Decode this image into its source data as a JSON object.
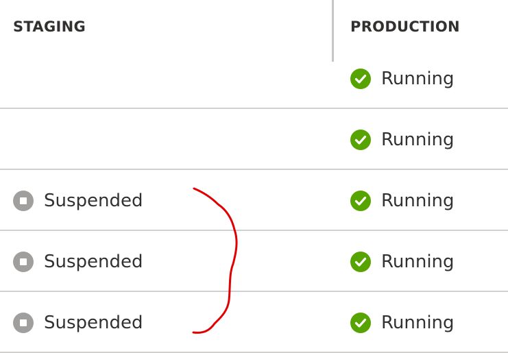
{
  "columns": {
    "staging": "STAGING",
    "production": "PRODUCTION"
  },
  "rows": [
    {
      "staging": null,
      "production": {
        "status": "Running",
        "icon": "check-circle-icon"
      }
    },
    {
      "staging": null,
      "production": {
        "status": "Running",
        "icon": "check-circle-icon"
      }
    },
    {
      "staging": {
        "status": "Suspended",
        "icon": "stop-circle-icon"
      },
      "production": {
        "status": "Running",
        "icon": "check-circle-icon"
      }
    },
    {
      "staging": {
        "status": "Suspended",
        "icon": "stop-circle-icon"
      },
      "production": {
        "status": "Running",
        "icon": "check-circle-icon"
      }
    },
    {
      "staging": {
        "status": "Suspended",
        "icon": "stop-circle-icon"
      },
      "production": {
        "status": "Running",
        "icon": "check-circle-icon"
      }
    }
  ],
  "colors": {
    "running": "#57a300",
    "suspended": "#a19f9d",
    "annotation": "#e00000"
  }
}
